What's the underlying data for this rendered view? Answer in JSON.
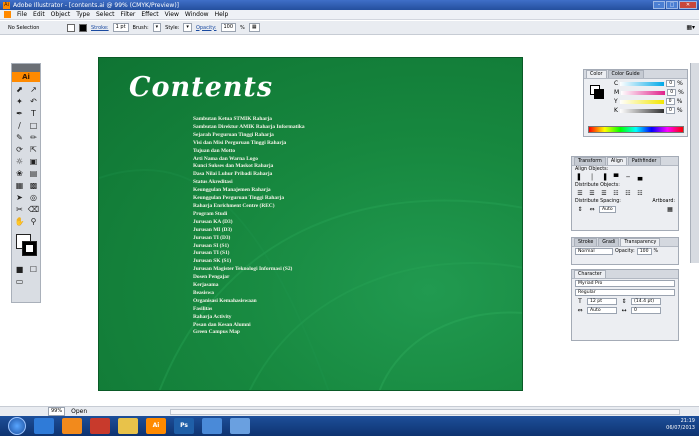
{
  "window": {
    "title": "Adobe Illustrator - [contents.ai @ 99% (CMYK/Preview)]",
    "app_icon_label": "Ai"
  },
  "menu": [
    "File",
    "Edit",
    "Object",
    "Type",
    "Select",
    "Filter",
    "Effect",
    "View",
    "Window",
    "Help"
  ],
  "control_bar": {
    "selection": "No Selection",
    "stroke_label": "Stroke:",
    "stroke_value": "1 pt",
    "brush_label": "Brush:",
    "style_label": "Style:",
    "opacity_label": "Opacity:",
    "opacity_value": "100",
    "percent": "%"
  },
  "tools": {
    "logo": "Ai"
  },
  "artboard": {
    "title": "Contents",
    "items": [
      "Sambutan Ketua STMIK Raharja",
      "Sambutan Direktur AMIK Raharja Informatika",
      "Sejarah Perguruan Tinggi Raharja",
      "Visi dan Misi Perguruan Tinggi Raharja",
      "Tujuan dan Motto",
      "Arti Nama dan Warna Logo",
      "Kunci Sukses dan Maskot Raharja",
      "Dasa Nilai Luhur Pribadi Raharja",
      "Status Akreditasi",
      "Keunggulan Manajemen Raharja",
      "Keunggulan Perguruan Tinggi Raharja",
      "Raharja Enrichment Centre (REC)",
      "Program Studi",
      "Jurusan KA (D3)",
      "Jurusan MI (D3)",
      "Jurusan TI (D3)",
      "Jurusan SI (S1)",
      "Jurusan TI (S1)",
      "Jurusan SK (S1)",
      "Jurusan Magister Teknologi Informasi (S2)",
      "Dosen Pengajar",
      "Kerjasama",
      "Beasiswa",
      "Organisasi Kemahasiswaan",
      "Fasilitas",
      "Raharja Activity",
      "Pesan dan Kesan Alumni",
      "Green Campus Map"
    ]
  },
  "color_panel": {
    "tabs": [
      "Color",
      "Color Guide"
    ],
    "channels": [
      {
        "label": "C",
        "value": "0",
        "color": "#00a8e8"
      },
      {
        "label": "M",
        "value": "0",
        "color": "#e0208a"
      },
      {
        "label": "Y",
        "value": "0",
        "color": "#f2e600"
      },
      {
        "label": "K",
        "value": "0",
        "color": "#333333"
      }
    ],
    "unit": "%"
  },
  "align_panel": {
    "tabs": [
      "Transform",
      "Align",
      "Pathfinder"
    ],
    "align_objects": "Align Objects:",
    "distribute_objects": "Distribute Objects:",
    "distribute_spacing": "Distribute Spacing:",
    "artboard_label": "Artboard:",
    "spacing_value": "Auto"
  },
  "transparency_panel": {
    "tabs": [
      "Stroke",
      "Gradi",
      "Transparency"
    ],
    "mode": "Normal",
    "opacity_label": "Opacity:",
    "opacity_value": "100",
    "percent": "%"
  },
  "character_panel": {
    "tab": "Character",
    "font": "Myriad Pro",
    "style": "Regular",
    "size": "12 pt",
    "leading": "(14.4 pt)",
    "kerning": "Auto",
    "tracking": "0"
  },
  "status_bar": {
    "zoom": "99%",
    "status": "Open"
  },
  "taskbar": {
    "buttons": [
      {
        "label": "",
        "color": "#2f7bd8"
      },
      {
        "label": "",
        "color": "#f28a1c"
      },
      {
        "label": "",
        "color": "#c83a2c"
      },
      {
        "label": "",
        "color": "#e8c24a"
      },
      {
        "label": "Ai",
        "color": "#ff8a00"
      },
      {
        "label": "Ps",
        "color": "#1f5fa8"
      },
      {
        "label": "",
        "color": "#4a8ad8"
      },
      {
        "label": "",
        "color": "#6aa0e0"
      }
    ],
    "time": "21:19",
    "date": "06/07/2013"
  }
}
